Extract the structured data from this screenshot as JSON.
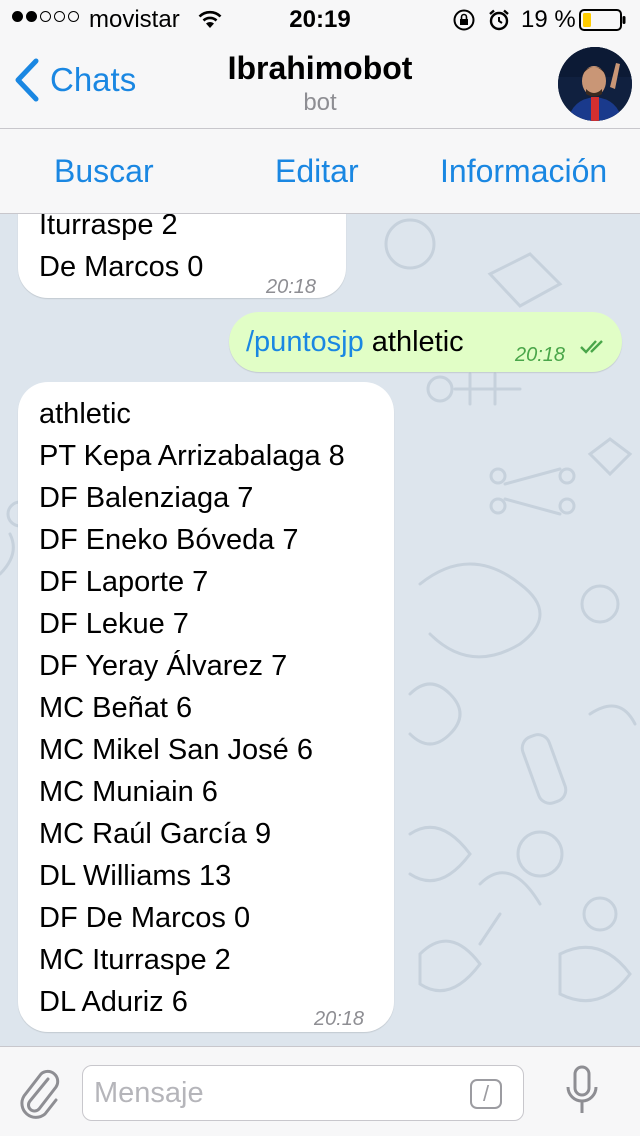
{
  "status_bar": {
    "carrier": "movistar",
    "time": "20:19",
    "battery": "19 %"
  },
  "header": {
    "back_label": "Chats",
    "title": "Ibrahimobot",
    "subtitle": "bot"
  },
  "actions": {
    "search": "Buscar",
    "edit": "Editar",
    "info": "Información"
  },
  "messages": [
    {
      "direction": "incoming",
      "lines": [
        "Iturraspe 2",
        "De Marcos 0"
      ],
      "time": "20:18"
    },
    {
      "direction": "outgoing",
      "command": "/puntosjp",
      "argument": " athletic",
      "time": "20:18",
      "status": "read"
    },
    {
      "direction": "incoming",
      "lines": [
        "athletic",
        "PT Kepa Arrizabalaga 8",
        "DF Balenziaga 7",
        "DF Eneko Bóveda 7",
        "DF Laporte 7",
        "DF Lekue 7",
        "DF Yeray Álvarez 7",
        "MC Beñat 6",
        "MC Mikel San José 6",
        "MC Muniain 6",
        "MC Raúl García 9",
        "DL Williams 13",
        "DF De Marcos 0",
        "MC Iturraspe 2",
        "DL Aduriz 6"
      ],
      "time": "20:18"
    }
  ],
  "input": {
    "placeholder": "Mensaje",
    "value": "",
    "commands_button": "/"
  },
  "colors": {
    "accent": "#1a87e2",
    "outgoing_bubble": "#e1fec6",
    "incoming_bubble": "#ffffff",
    "chat_background": "#dde5ed",
    "battery_low": "#ffcc00"
  },
  "icons": [
    "signal-dots",
    "wifi-icon",
    "lock-rotation-icon",
    "alarm-icon",
    "battery-icon",
    "back-chevron-icon",
    "double-check-icon",
    "paperclip-icon",
    "slash-command-icon",
    "microphone-icon"
  ]
}
